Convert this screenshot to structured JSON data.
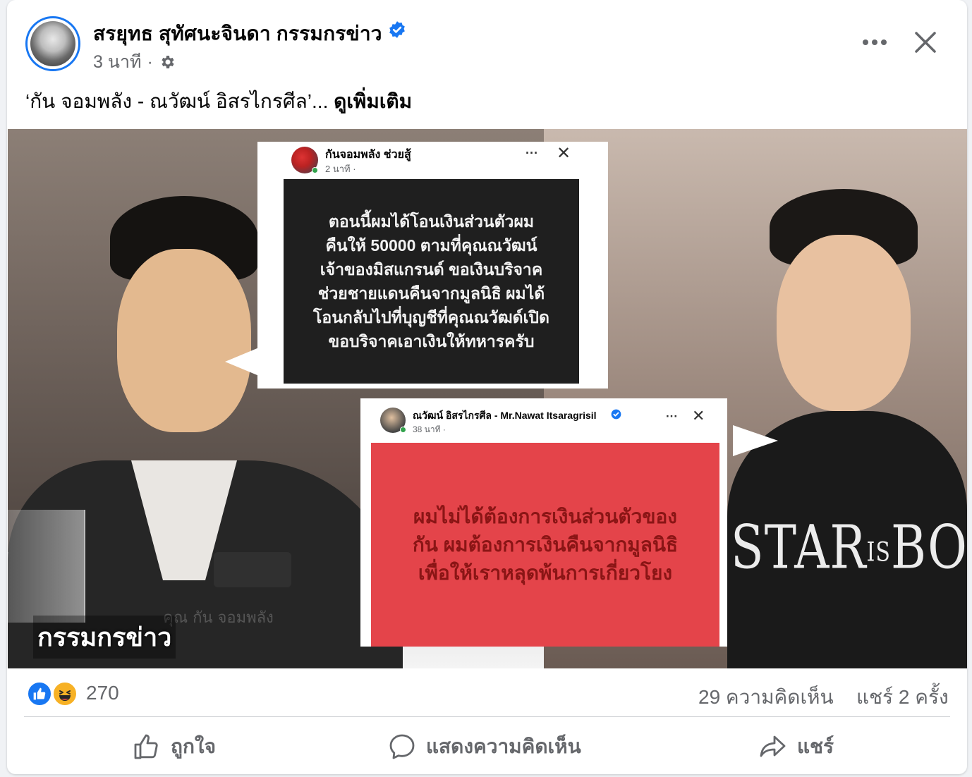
{
  "post": {
    "author": "สรยุทธ สุทัศนะจินดา กรรมกรข่าว",
    "time": "3 นาที",
    "separator": "·",
    "caption": "‘กัน จอมพลัง - ณวัฒน์ อิสรไกรศีล’...",
    "see_more": "ดูเพิ่มเติม"
  },
  "image": {
    "watermark": "กรรมกรข่าว",
    "nameplate": "คุณ กัน จอมพลัง",
    "shirt_text_1": "STAR",
    "shirt_text_small": "IS",
    "shirt_text_2": "BORN",
    "post1": {
      "name": "กันจอมพลัง ช่วยสู้",
      "time": "2 นาที ·",
      "more": "···",
      "close": "✕",
      "text": "ตอนนี้ผมได้โอนเงินส่วนตัวผม\nคืนให้ 50000 ตามที่คุณณวัฒน์\nเจ้าของมิสแกรนด์ ขอเงินบริจาค\nช่วยชายแดนคืนจากมูลนิธิ ผมได้\nโอนกลับไปที่บุญชีที่คุณณวัฒด์เปิด\nขอบริจาคเอาเงินให้ทหารครับ"
    },
    "post2": {
      "name": "ณวัฒน์ อิสรไกรศีล - Mr.Nawat Itsaragrisil",
      "time": "38 นาที ·",
      "more": "···",
      "close": "✕",
      "text": "ผมไม่ได้ต้องการเงินส่วนตัวของ\nกัน ผมต้องการเงินคืนจากมูลนิธิ\nเพื่อให้เราหลุดพ้นการเกี่ยวโยง",
      "box_color": "#e4444a"
    }
  },
  "stats": {
    "reactions_count": "270",
    "comments": "29 ความคิดเห็น",
    "shares": "แชร์ 2 ครั้ง"
  },
  "actions": {
    "like": "ถูกใจ",
    "comment": "แสดงความคิดเห็น",
    "share": "แชร์"
  },
  "colors": {
    "accent": "#1877f2",
    "secondary_text": "#65676b",
    "haha": "#f7b125"
  }
}
